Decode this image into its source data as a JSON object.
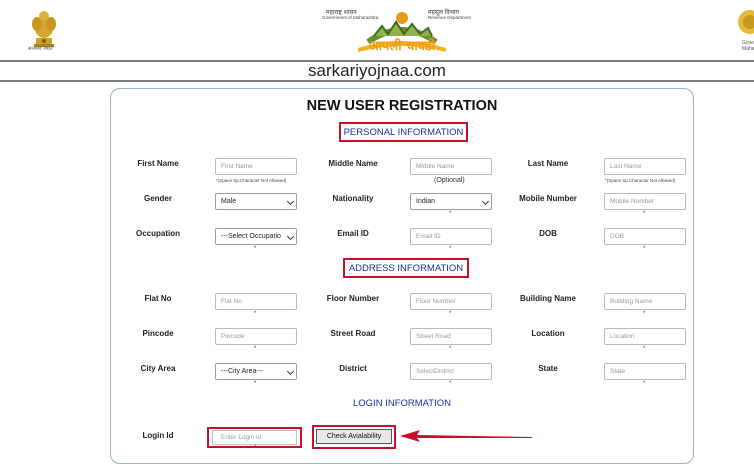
{
  "header": {
    "left_emblem_caption": "सत्यमेव जयते",
    "center_top_left": "महाराष्ट्र शासन",
    "center_top_left_en": "Government of Maharashtra",
    "center_top_right": "महसूल विभाग",
    "center_top_right_en": "Revenue Department",
    "center_logo_text": "आपली चावडी",
    "right_caption": "Gove Maha",
    "site_name": "sarkariyojnaa.com"
  },
  "form": {
    "title": "NEW USER REGISTRATION",
    "sections": {
      "personal": "PERSONAL INFORMATION",
      "address": "ADDRESS INFORMATION",
      "login": "LOGIN INFORMATION"
    },
    "labels": {
      "first_name": "First Name",
      "middle_name": "Middle Name",
      "last_name": "Last Name",
      "gender": "Gender",
      "nationality": "Nationality",
      "mobile": "Mobile Number",
      "occupation": "Occupation",
      "email": "Email ID",
      "dob": "DOB",
      "flat": "Flat No",
      "floor": "Floor Number",
      "building": "Building Name",
      "pincode": "Pincode",
      "street": "Street Road",
      "location": "Location",
      "city_area": "City Area",
      "district": "District",
      "state": "State",
      "login_id": "Login Id"
    },
    "placeholders": {
      "first_name": "First Name",
      "middle_name": "Middle Name",
      "last_name": "Last Name",
      "mobile": "Mobile Number",
      "email": "Email ID",
      "dob": "DOB",
      "flat": "Flat No",
      "floor": "Floor Number",
      "building": "Building Name",
      "pincode": "Pincode",
      "street": "Street Road",
      "location": "Location",
      "district": "SelectDistrict",
      "state": "State",
      "login_id": "Enter Login Id"
    },
    "selects": {
      "gender": "Male",
      "nationality": "Indian",
      "occupation": "---Select Occupatio",
      "city_area": "---City Area---"
    },
    "hints": {
      "no_space": "*(Space Sp.Character Not Allowed)",
      "optional": "(Optional)",
      "required": "*"
    },
    "buttons": {
      "check_availability": "Check Avialability"
    }
  },
  "colors": {
    "highlight_red": "#c8102e",
    "section_blue": "#1c2f9e",
    "card_border": "#9ab3c4"
  }
}
